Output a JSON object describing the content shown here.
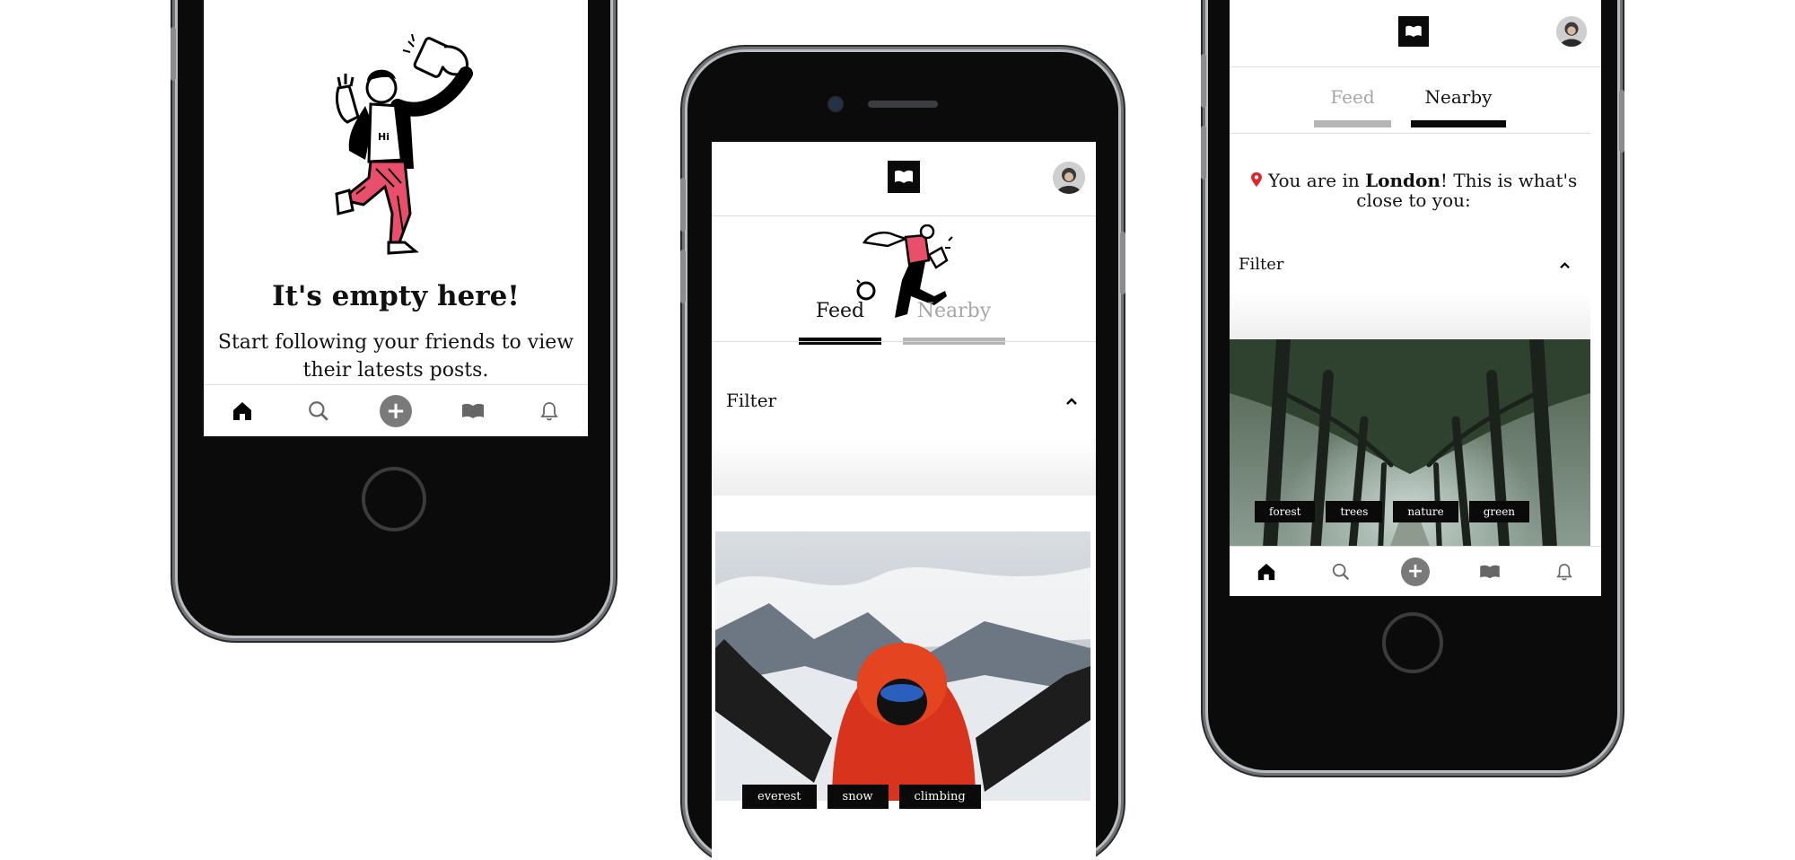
{
  "app": {
    "nav_icons": [
      "home-icon",
      "search-icon",
      "add-icon",
      "book-icon",
      "bell-icon"
    ],
    "plus_glyph": "+"
  },
  "phone_left": {
    "empty_title": "It's empty here!",
    "empty_message": "Start following your friends to view their latests posts."
  },
  "phone_center": {
    "tabs": [
      {
        "label": "Feed",
        "active": true
      },
      {
        "label": "Nearby",
        "active": false
      }
    ],
    "filter_label": "Filter",
    "tags": [
      "everest",
      "snow",
      "climbing"
    ]
  },
  "phone_right": {
    "tabs": [
      {
        "label": "Feed",
        "active": false
      },
      {
        "label": "Nearby",
        "active": true
      }
    ],
    "location_prefix": "You are in ",
    "location_city": "London",
    "location_suffix": "! This is what's close to you:",
    "filter_label": "Filter",
    "tags": [
      "forest",
      "trees",
      "nature",
      "green"
    ]
  },
  "colors": {
    "accent_pink": "#e94f6a",
    "black": "#0a0a0a",
    "inactive_gray": "#a6a6a6"
  }
}
